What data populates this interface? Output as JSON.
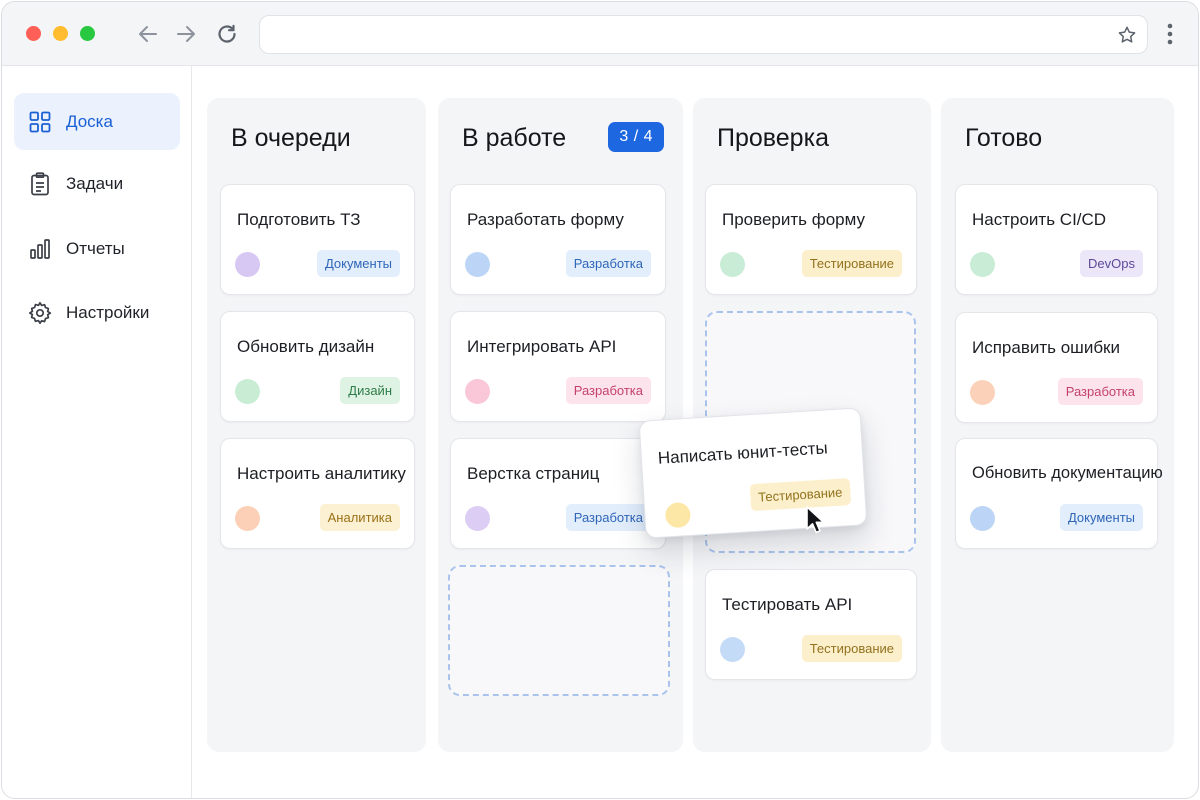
{
  "sidebar": {
    "items": [
      {
        "label": "Доска",
        "icon": "grid-icon",
        "active": true
      },
      {
        "label": "Задачи",
        "icon": "clipboard-icon"
      },
      {
        "label": "Отчеты",
        "icon": "bar-chart-icon"
      },
      {
        "label": "Настройки",
        "icon": "gear-icon"
      }
    ]
  },
  "board": {
    "columns": [
      {
        "title": "В очереди",
        "cards": [
          {
            "title": "Подготовить ТЗ",
            "tag": "Документы"
          },
          {
            "title": "Обновить дизайн",
            "tag": "Дизайн"
          },
          {
            "title": "Настроить аналитику",
            "tag": "Аналитика"
          }
        ]
      },
      {
        "title": "В работе",
        "counter": "3 / 4",
        "cards": [
          {
            "title": "Разработать форму",
            "tag": "Разработка"
          },
          {
            "title": "Интегрировать API",
            "tag": "Разработка"
          },
          {
            "title": "Верстка страниц",
            "tag": "Разработка"
          }
        ]
      },
      {
        "title": "Проверка",
        "cards": [
          {
            "title": "Проверить форму",
            "tag": "Тестирование"
          },
          {
            "title": "Тестировать API",
            "tag": "Тестирование"
          }
        ]
      },
      {
        "title": "Готово",
        "cards": [
          {
            "title": "Настроить CI/CD",
            "tag": "DevOps"
          },
          {
            "title": "Исправить ошибки",
            "tag": "Разработка"
          },
          {
            "title": "Обновить документацию",
            "tag": "Документы"
          }
        ]
      }
    ],
    "dragged_card": {
      "title": "Написать юнит-тесты",
      "tag": "Тестирование"
    }
  },
  "colors": {
    "accent": "#1d67e0",
    "tag_docs": "#e3eefc",
    "tag_design": "#dff3e4",
    "tag_analytics": "#fdf1d3",
    "tag_dev_blue": "#e2eefc",
    "tag_dev_pink": "#fde4ec",
    "tag_testing": "#fcf0cc",
    "tag_devops": "#ebe6f8"
  }
}
